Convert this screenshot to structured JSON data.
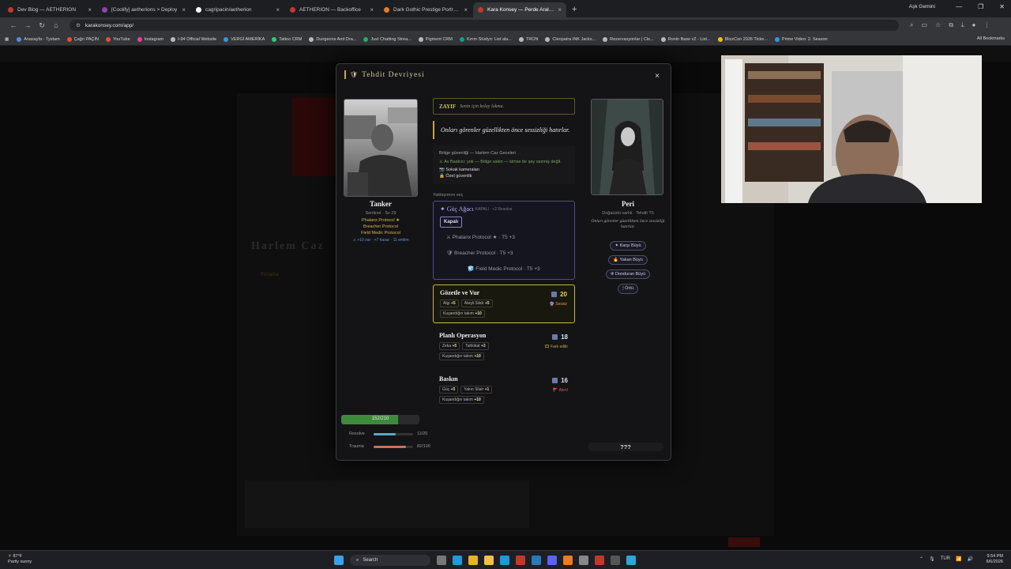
{
  "browser": {
    "tabs": [
      {
        "title": "Dev Blog — AETHERION",
        "color": "#c0392b",
        "active": false
      },
      {
        "title": "[Coolify] aetherions > Deploy",
        "color": "#8e44ad",
        "active": false
      },
      {
        "title": "cagripacin/aetherion",
        "color": "#ffffff",
        "active": false
      },
      {
        "title": "AETHERION — Backoffice",
        "color": "#c0392b",
        "active": false
      },
      {
        "title": "Dark Gothic Prestige Portraits",
        "color": "#e67e22",
        "active": false
      },
      {
        "title": "Kara Konsey — Perde Aralangı",
        "color": "#c0392b",
        "active": true
      }
    ],
    "profile": "Aşk Gemini",
    "url": "karakonsey.com/app/",
    "bookmarks": [
      {
        "label": "Anasayfa - Tystam",
        "color": "#4a90e2"
      },
      {
        "label": "Çağrı PAÇİN",
        "color": "#e74c3c"
      },
      {
        "label": "YouTube",
        "color": "#e74c3c"
      },
      {
        "label": "Instagram",
        "color": "#e84393"
      },
      {
        "label": "I-94 Official Website",
        "color": "#bbbbbb"
      },
      {
        "label": "VERGİ AMERİKA",
        "color": "#3498db"
      },
      {
        "label": "Tattoo CRM",
        "color": "#2ecc71"
      },
      {
        "label": "Dungeons And Dra...",
        "color": "#bbbbbb"
      },
      {
        "label": "Just Chatting Strea...",
        "color": "#27ae60"
      },
      {
        "label": "Pigment CRM",
        "color": "#bbbbbb"
      },
      {
        "label": "Kırım Stüdyo: List ala...",
        "color": "#16a085"
      },
      {
        "label": "TRON",
        "color": "#bbbbbb"
      },
      {
        "label": "Cleopatra INK Jacks...",
        "color": "#bbbbbb"
      },
      {
        "label": "Rezervasyonlar | Cle...",
        "color": "#bbbbbb"
      },
      {
        "label": "Ronin Base v2 - List...",
        "color": "#bbbbbb"
      },
      {
        "label": "BlizzCon 2026 Ticke...",
        "color": "#f1c40f"
      },
      {
        "label": "Prime Video: 2. Season",
        "color": "#3498db"
      }
    ],
    "all_bookmarks": "All Bookmarks"
  },
  "background": {
    "heading": "Harlem Caz",
    "section": "Fırsatlar"
  },
  "modal": {
    "title": "Tehdit Devriyesi",
    "close": "×",
    "player": {
      "name": "Tanker",
      "class_line": "Sentinel · Sv 29",
      "titles": [
        "Phalanx Protocol ★",
        "Breacher Protocol",
        "Field Medic Protocol"
      ],
      "bonus": "⚔ +10 zar · +7 hasar · 11 emlim",
      "hp": {
        "text": "152/210",
        "fraction": 0.724
      },
      "resolve": {
        "label": "Resolve",
        "value": "11/20",
        "fraction": 0.55,
        "color": "#5aa7c9"
      },
      "trauma": {
        "label": "Trauma",
        "value": "82/100",
        "fraction": 0.82,
        "color": "#c8715a"
      }
    },
    "threat": {
      "weak_label": "ZAYIF",
      "weak_text": "Senin için kolay lokma.",
      "quote": "Onları görenler güzellikten önce sessizliği hatırlar.",
      "security_title": "Bölge güvenliği — Harlem Caz Geceleri",
      "security_alert": "⚔ Av Baskısı: yok — Bölge sakin — kimse bir şey sezmiş değil.",
      "security_items": [
        "📷 Sokak kameraları",
        "🔒 Özel güvenlik"
      ],
      "choose_label": "Yaklaşımını seç",
      "skill_tree": {
        "title": "✦ Güç Ağacı",
        "meta": "KAPALI · +2 Resolve",
        "toggle": "Kapalı",
        "items": [
          "⚔ Phalanx Protocol ★ · T5 +3",
          "🛡 Breacher Protocol · T5 +3",
          "🧊 Field Medic Protocol · T5 +3"
        ]
      },
      "approaches": [
        {
          "name": "Gözetle ve Vur",
          "score": "20",
          "tag": "🔮 Sessiz",
          "tag_color": "#c7a44a",
          "selected": true,
          "chips": [
            {
              "k": "Algı",
              "v": "+5"
            },
            {
              "k": "Ateşli Silah",
              "v": "+5"
            },
            {
              "k": "Kuşandığın takım",
              "v": "+10"
            }
          ]
        },
        {
          "name": "Planlı Operasyon",
          "score": "18",
          "tag": "🎞 Fark edilir",
          "tag_color": "#c7a44a",
          "selected": false,
          "chips": [
            {
              "k": "Zeka",
              "v": "+5"
            },
            {
              "k": "Tahkikat",
              "v": "+3"
            },
            {
              "k": "Kuşandığın takım",
              "v": "+10"
            }
          ]
        },
        {
          "name": "Baskın",
          "score": "16",
          "tag": "🚩 Alenî",
          "tag_color": "#d06060",
          "selected": false,
          "chips": [
            {
              "k": "Güç",
              "v": "+5"
            },
            {
              "k": "Yakın Silah",
              "v": "+1"
            },
            {
              "k": "Kuşandığın takım",
              "v": "+10"
            }
          ]
        }
      ]
    },
    "enemy": {
      "name": "Peri",
      "class_line": "Doğaüstü varlık · Tehdit T5",
      "quote": "Onları görenler güzellikten önce sessizliği hatırlar.",
      "spells": [
        "✦ Karşı Büyü",
        "🔥 Yakan Büyü",
        "❄ Donduran Büyü",
        "🕯 Örtü"
      ],
      "mystery": "???"
    }
  },
  "taskbar": {
    "weather_temp": "87°F",
    "weather_desc": "Partly sunny",
    "search": "Search",
    "lang": "TUR",
    "time": "9:54 PM",
    "date": "6/6/2026"
  }
}
